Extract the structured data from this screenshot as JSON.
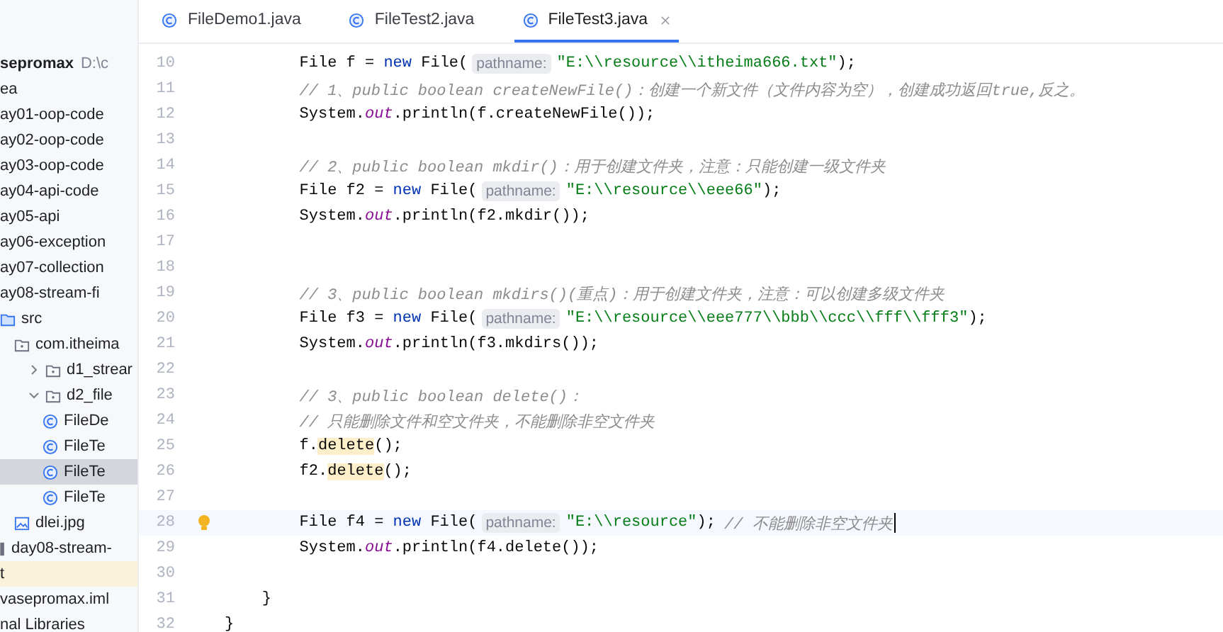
{
  "project_tree": [
    {
      "label": "sepromax",
      "detail": "D:\\c",
      "kind": "root",
      "selected": false,
      "children": [
        {
          "label": "ea",
          "kind": "plain",
          "selected": false
        },
        {
          "label": "ay01-oop-code",
          "kind": "plain",
          "selected": false
        },
        {
          "label": "ay02-oop-code",
          "kind": "plain",
          "selected": false
        },
        {
          "label": "ay03-oop-code",
          "kind": "plain",
          "selected": false
        },
        {
          "label": "ay04-api-code",
          "kind": "plain",
          "selected": false
        },
        {
          "label": "ay05-api",
          "kind": "plain",
          "selected": false
        },
        {
          "label": "ay06-exception",
          "kind": "plain",
          "selected": false
        },
        {
          "label": "ay07-collection",
          "kind": "plain",
          "selected": false
        },
        {
          "label": "ay08-stream-fi",
          "kind": "plain",
          "selected": false,
          "children": [
            {
              "label": "src",
              "kind": "source-folder",
              "selected": false,
              "children": [
                {
                  "label": "com.itheima",
                  "kind": "package",
                  "selected": false,
                  "children": [
                    {
                      "label": "d1_strear",
                      "kind": "package",
                      "expanded": false,
                      "selected": false
                    },
                    {
                      "label": "d2_file",
                      "kind": "package",
                      "expanded": true,
                      "selected": false,
                      "children": [
                        {
                          "label": "FileDe",
                          "kind": "class",
                          "selected": false
                        },
                        {
                          "label": "FileTe",
                          "kind": "class",
                          "selected": false
                        },
                        {
                          "label": "FileTe",
                          "kind": "class",
                          "selected": true
                        },
                        {
                          "label": "FileTe",
                          "kind": "class",
                          "selected": false
                        }
                      ]
                    }
                  ]
                },
                {
                  "label": "dlei.jpg",
                  "kind": "image",
                  "selected": false
                }
              ]
            },
            {
              "label": "day08-stream-",
              "kind": "module-file",
              "selected": false
            }
          ]
        },
        {
          "label": "t",
          "kind": "excluded-folder",
          "selected": false
        },
        {
          "label": "vasepromax.iml",
          "kind": "plain",
          "selected": false
        }
      ]
    },
    {
      "label": "nal Libraries",
      "kind": "plain",
      "selected": false
    }
  ],
  "tabs": [
    {
      "label": "FileDemo1.java",
      "selected": false
    },
    {
      "label": "FileTest2.java",
      "selected": false
    },
    {
      "label": "FileTest3.java",
      "selected": true
    }
  ],
  "editor": {
    "blocks": [
      {
        "kind": "method-body",
        "lines": [
          {
            "number": "10",
            "current": false,
            "tokens": [
              {
                "kind": "text",
                "text": "File f = "
              },
              {
                "kind": "keyword",
                "text": "new"
              },
              {
                "kind": "text",
                "text": " File("
              },
              {
                "kind": "hint",
                "text": "pathname:"
              },
              {
                "kind": "string",
                "text": "\"E:\\\\resource\\\\itheima666.txt\""
              },
              {
                "kind": "text",
                "text": ");"
              }
            ]
          },
          {
            "number": "11",
            "current": false,
            "tokens": [
              {
                "kind": "comment",
                "text": "// 1、public boolean createNewFile()：创建一个新文件（文件内容为空），创建成功返回true,反之。"
              }
            ]
          },
          {
            "number": "12",
            "current": false,
            "tokens": [
              {
                "kind": "text",
                "text": "System."
              },
              {
                "kind": "static",
                "text": "out"
              },
              {
                "kind": "text",
                "text": ".println(f.createNewFile());"
              }
            ]
          },
          {
            "number": "13",
            "current": false
          },
          {
            "number": "14",
            "current": false,
            "tokens": [
              {
                "kind": "comment",
                "text": "// 2、public boolean mkdir()：用于创建文件夹，注意：只能创建一级文件夹"
              }
            ]
          },
          {
            "number": "15",
            "current": false,
            "tokens": [
              {
                "kind": "text",
                "text": "File f2 = "
              },
              {
                "kind": "keyword",
                "text": "new"
              },
              {
                "kind": "text",
                "text": " File("
              },
              {
                "kind": "hint",
                "text": "pathname:"
              },
              {
                "kind": "string",
                "text": "\"E:\\\\resource\\\\eee66\""
              },
              {
                "kind": "text",
                "text": ");"
              }
            ]
          },
          {
            "number": "16",
            "current": false,
            "tokens": [
              {
                "kind": "text",
                "text": "System."
              },
              {
                "kind": "static",
                "text": "out"
              },
              {
                "kind": "text",
                "text": ".println(f2.mkdir());"
              }
            ]
          },
          {
            "number": "17",
            "current": false
          },
          {
            "number": "18",
            "current": false
          },
          {
            "number": "19",
            "current": false,
            "tokens": [
              {
                "kind": "comment",
                "text": "// 3、public boolean mkdirs()(重点)：用于创建文件夹，注意：可以创建多级文件夹"
              }
            ]
          },
          {
            "number": "20",
            "current": false,
            "tokens": [
              {
                "kind": "text",
                "text": "File f3 = "
              },
              {
                "kind": "keyword",
                "text": "new"
              },
              {
                "kind": "text",
                "text": " File("
              },
              {
                "kind": "hint",
                "text": "pathname:"
              },
              {
                "kind": "string",
                "text": "\"E:\\\\resource\\\\eee777\\\\bbb\\\\ccc\\\\fff\\\\fff3\""
              },
              {
                "kind": "text",
                "text": ");"
              }
            ]
          },
          {
            "number": "21",
            "current": false,
            "tokens": [
              {
                "kind": "text",
                "text": "System."
              },
              {
                "kind": "static",
                "text": "out"
              },
              {
                "kind": "text",
                "text": ".println(f3.mkdirs());"
              }
            ]
          },
          {
            "number": "22",
            "current": false
          },
          {
            "number": "23",
            "current": false,
            "tokens": [
              {
                "kind": "comment",
                "text": "// 3、public boolean delete()："
              }
            ]
          },
          {
            "number": "24",
            "current": false,
            "tokens": [
              {
                "kind": "comment",
                "text": "// 只能删除文件和空文件夹，不能删除非空文件夹"
              }
            ]
          },
          {
            "number": "25",
            "current": false,
            "tokens": [
              {
                "kind": "text",
                "text": "f."
              },
              {
                "kind": "usage",
                "text": "delete"
              },
              {
                "kind": "text",
                "text": "();"
              }
            ]
          },
          {
            "number": "26",
            "current": false,
            "tokens": [
              {
                "kind": "text",
                "text": "f2."
              },
              {
                "kind": "usage",
                "text": "delete"
              },
              {
                "kind": "text",
                "text": "();"
              }
            ]
          },
          {
            "number": "27",
            "current": false
          },
          {
            "number": "28",
            "current": true,
            "bulb": true,
            "tokens": [
              {
                "kind": "text",
                "text": "File f4 = "
              },
              {
                "kind": "keyword",
                "text": "new"
              },
              {
                "kind": "text",
                "text": " File("
              },
              {
                "kind": "hint",
                "text": "pathname:"
              },
              {
                "kind": "string",
                "text": "\"E:\\\\resource\""
              },
              {
                "kind": "text",
                "text": ");"
              },
              {
                "kind": "comment",
                "text": "// 不能删除非空文件夹"
              }
            ]
          },
          {
            "number": "29",
            "current": false,
            "tokens": [
              {
                "kind": "text",
                "text": "System."
              },
              {
                "kind": "static",
                "text": "out"
              },
              {
                "kind": "text",
                "text": ".println(f4.delete());"
              }
            ]
          },
          {
            "number": "30",
            "current": false
          }
        ]
      },
      {
        "kind": "method-close",
        "lines": [
          {
            "number": "31",
            "current": false,
            "tokens": [
              {
                "kind": "text",
                "text": "}"
              }
            ]
          }
        ]
      },
      {
        "kind": "class-close",
        "lines": [
          {
            "number": "32",
            "current": false,
            "tokens": [
              {
                "kind": "text",
                "text": "}"
              }
            ]
          }
        ]
      }
    ]
  }
}
